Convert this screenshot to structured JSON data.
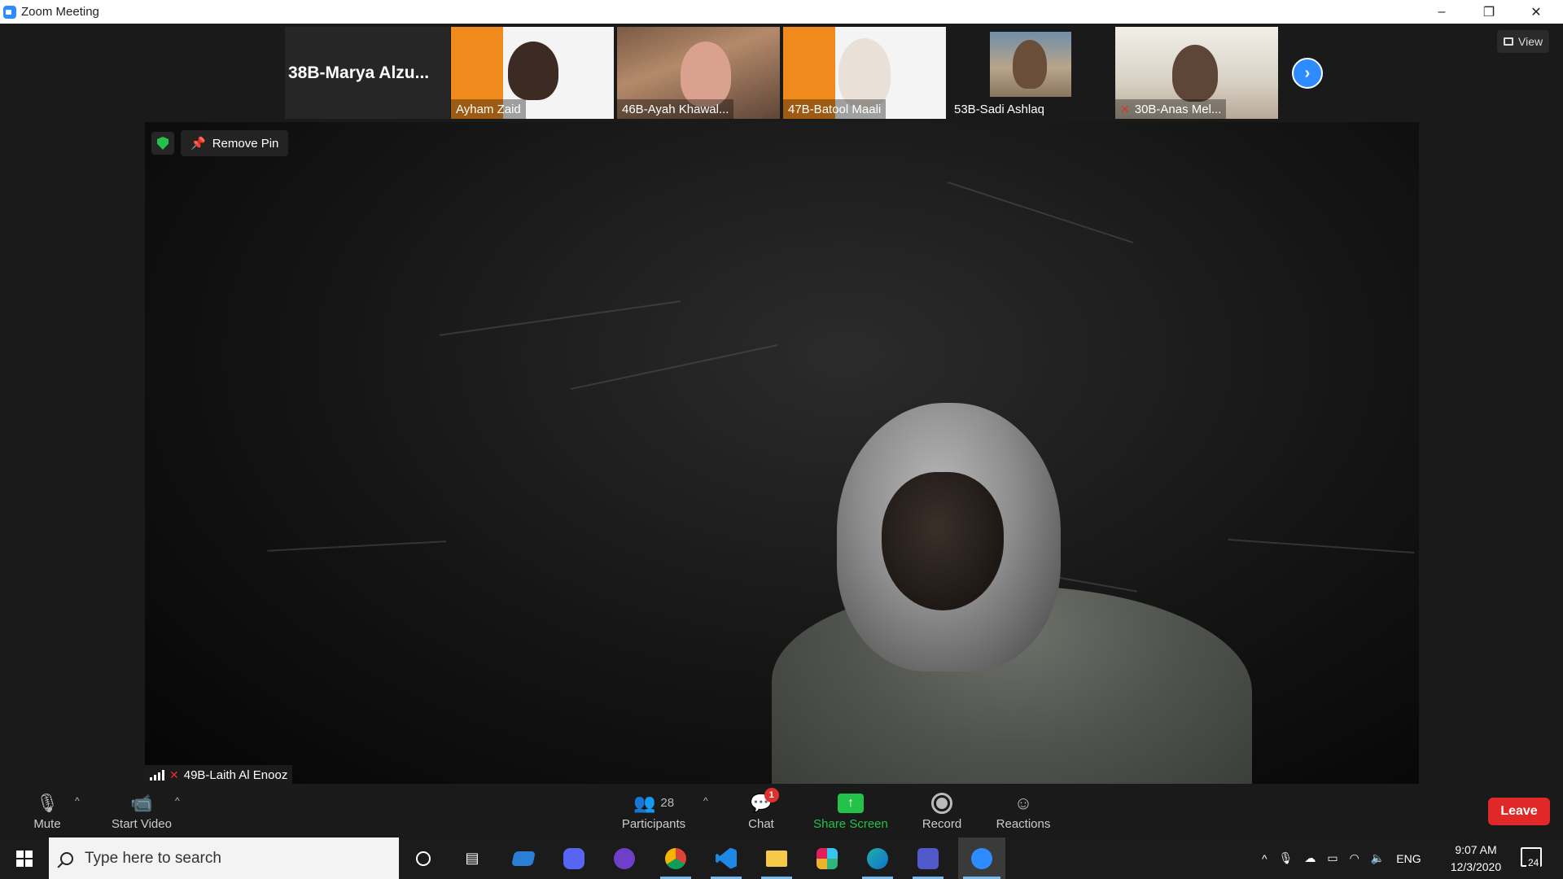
{
  "window": {
    "title": "Zoom Meeting",
    "minimize": "–",
    "restore": "❐",
    "close": "✕"
  },
  "strip": {
    "first_name": "38B-Marya  Alzu...",
    "thumbnails": [
      {
        "label": "Ayham Zaid",
        "muted": false
      },
      {
        "label": "46B-Ayah Khawal...",
        "muted": false
      },
      {
        "label": "47B-Batool Maali",
        "muted": false
      },
      {
        "label": "53B-Sadi Ashlaq",
        "muted": false
      },
      {
        "label": "30B-Anas Mel...",
        "muted": true
      }
    ],
    "next_icon": "chevron-right",
    "view_label": "View"
  },
  "main_video": {
    "remove_pin_label": "Remove Pin",
    "speaker_name": "49B-Laith Al Enooz"
  },
  "toolbar": {
    "mute_label": "Mute",
    "start_video_label": "Start Video",
    "participants_label": "Participants",
    "participants_count": "28",
    "chat_label": "Chat",
    "chat_badge": "1",
    "share_label": "Share Screen",
    "record_label": "Record",
    "reactions_label": "Reactions",
    "leave_label": "Leave",
    "colors": {
      "share": "#23c24a",
      "leave": "#e02828",
      "share_text": "#23c24a"
    }
  },
  "taskbar": {
    "search_placeholder": "Type here to search",
    "apps": [
      "cortana",
      "task-view",
      "network-app",
      "discord",
      "github-desktop",
      "chrome",
      "vscode",
      "file-explorer",
      "slack",
      "edge",
      "teams",
      "zoom"
    ],
    "language": "ENG",
    "time": "9:07 AM",
    "date": "12/3/2020",
    "notification_count": "24"
  }
}
